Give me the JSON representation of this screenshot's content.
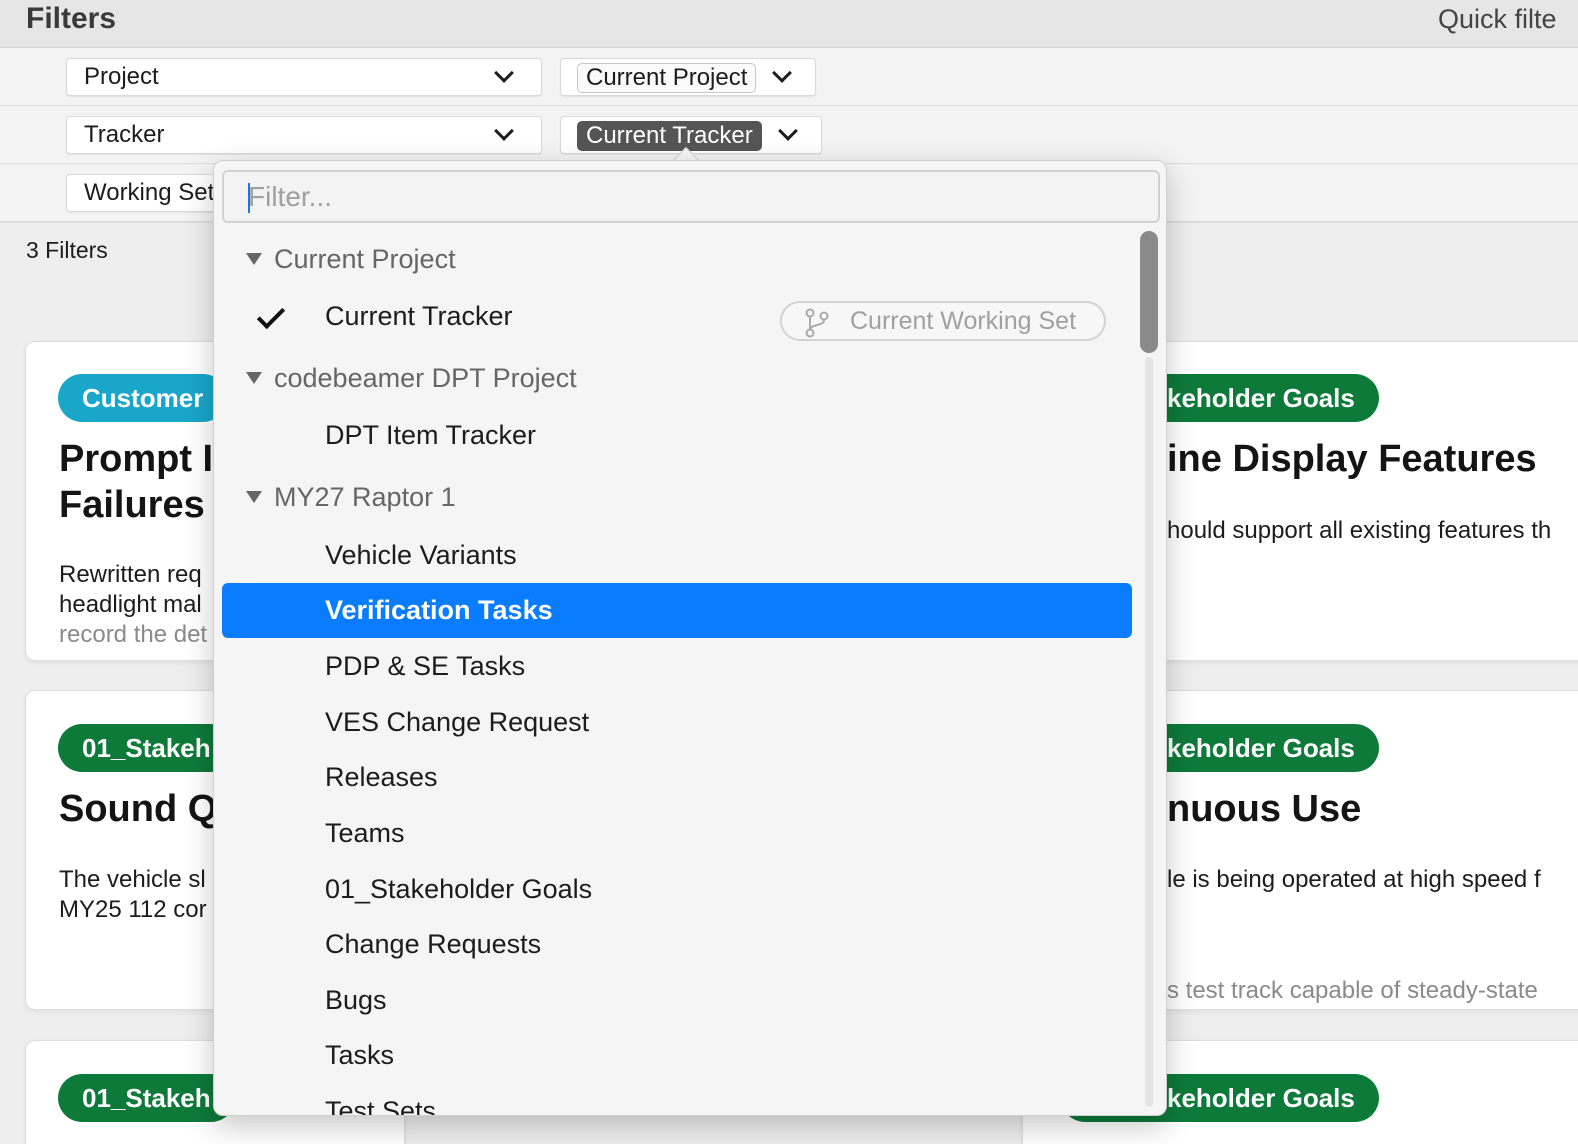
{
  "header": {
    "title": "Filters",
    "quick_filter_label": "Quick filte"
  },
  "filters": [
    {
      "field": "Project",
      "value": "Current Project"
    },
    {
      "field": "Tracker",
      "value": "Current Tracker"
    },
    {
      "field": "Working Set"
    }
  ],
  "filter_count": "3 Filters",
  "cards": {
    "left": [
      {
        "badge": "Customer",
        "title_lines": [
          "Prompt I",
          "Failures"
        ],
        "text_lines": [
          "Rewritten req",
          "headlight mal",
          "record the det"
        ]
      },
      {
        "badge": "01_Stakeh",
        "title_lines": [
          "Sound Q"
        ],
        "text_lines": [
          "The vehicle sl",
          "MY25 112 cor"
        ]
      },
      {
        "badge": "01_Stakeh"
      }
    ],
    "right": [
      {
        "badge": "keholder Goals",
        "title_lines": [
          "ine Display Features"
        ],
        "text_lines": [
          "hould support all existing features th"
        ]
      },
      {
        "badge": "keholder Goals",
        "title_lines": [
          "nuous Use"
        ],
        "text_lines": [
          "le is being operated at high speed f",
          "s test track capable of steady-state"
        ]
      },
      {
        "badge": "keholder Goals"
      }
    ]
  },
  "dropdown": {
    "search_placeholder": "Filter...",
    "groups": [
      {
        "label": "Current Project"
      },
      {
        "label": "codebeamer DPT Project"
      },
      {
        "label": "MY27 Raptor 1"
      }
    ],
    "current_tracker": {
      "label": "Current Tracker",
      "checked": true
    },
    "working_set_chip": "Current Working Set",
    "dpt_items": [
      "DPT Item Tracker"
    ],
    "raptor_items": [
      "Vehicle Variants",
      "Verification Tasks",
      "PDP & SE Tasks",
      "VES Change Request",
      "Releases",
      "Teams",
      "01_Stakeholder Goals",
      "Change Requests",
      "Bugs",
      "Tasks",
      "Test Sets"
    ],
    "selected_item": "Verification Tasks"
  },
  "colors": {
    "selected": "#0a7cff",
    "badge_blue": "#1aa6c9",
    "badge_green": "#0e7a3a"
  }
}
